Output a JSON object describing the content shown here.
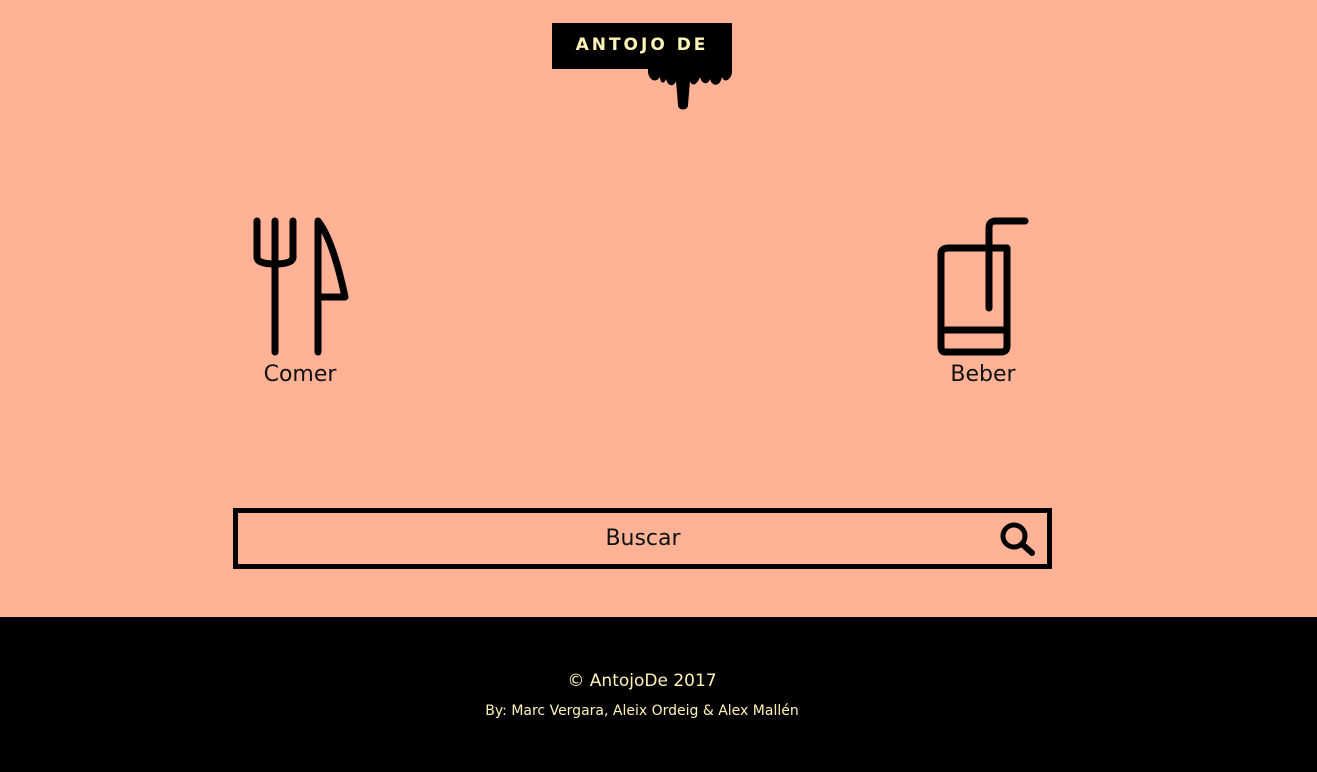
{
  "header": {
    "logo_text": "ANTOJO DE",
    "logo_icon": "dripping-paint-icon"
  },
  "options": [
    {
      "label": "Comer",
      "icon": "fork-knife-icon"
    },
    {
      "label": "Beber",
      "icon": "glass-straw-icon"
    }
  ],
  "search": {
    "placeholder": "Buscar",
    "value": "",
    "icon": "search-icon"
  },
  "footer": {
    "copyright": "© AntojoDe 2017",
    "authors": "By: Marc Vergara, Aleix Ordeig & Alex Mallén"
  },
  "colors": {
    "background": "#ffb296",
    "footer_background": "#000000",
    "footer_text": "#fff3b8",
    "accent": "#000000"
  }
}
